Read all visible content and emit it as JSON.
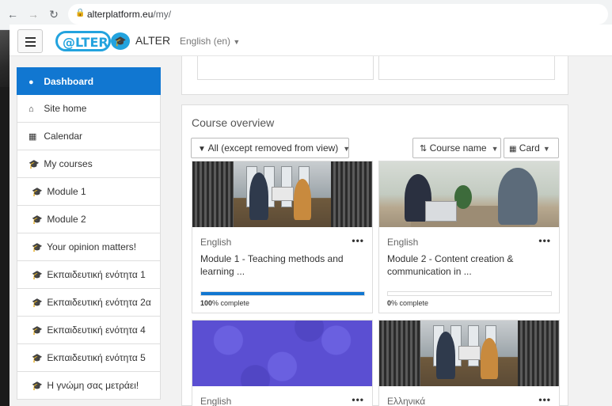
{
  "browser": {
    "url_host": "alterplatform.eu",
    "url_path": "/my/",
    "back_icon": "arrow-left-icon",
    "forward_icon": "arrow-right-icon",
    "reload_icon": "reload-icon",
    "lock_icon": "lock-icon"
  },
  "navbar": {
    "logo_text": "@LTER",
    "brand": "ALTER",
    "language": "English (en)"
  },
  "sidebar": {
    "items": [
      {
        "label": "Dashboard",
        "icon": "dashboard-icon",
        "active": true
      },
      {
        "label": "Site home",
        "icon": "home-icon"
      },
      {
        "label": "Calendar",
        "icon": "calendar-icon"
      },
      {
        "label": "My courses",
        "icon": "graduation-cap-icon"
      },
      {
        "label": "Module 1",
        "icon": "graduation-cap-icon"
      },
      {
        "label": "Module 2",
        "icon": "graduation-cap-icon"
      },
      {
        "label": "Your opinion matters!",
        "icon": "graduation-cap-icon"
      },
      {
        "label": "Εκπαιδευτική ενότητα 1",
        "icon": "graduation-cap-icon"
      },
      {
        "label": "Εκπαιδευτική ενότητα 2α",
        "icon": "graduation-cap-icon"
      },
      {
        "label": "Εκπαιδευτική ενότητα 4",
        "icon": "graduation-cap-icon"
      },
      {
        "label": "Εκπαιδευτική ενότητα 5",
        "icon": "graduation-cap-icon"
      },
      {
        "label": "Η γνώμη σας μετράει!",
        "icon": "graduation-cap-icon"
      }
    ]
  },
  "overview": {
    "title": "Course overview",
    "filter_label": "All (except removed from view)",
    "sort_label": "Course name",
    "view_label": "Card",
    "courses": [
      {
        "category": "English",
        "name": "Module 1 - Teaching methods and learning ...",
        "progress": 100,
        "progress_text": "% complete",
        "progress_value": "100"
      },
      {
        "category": "English",
        "name": "Module 2 - Content creation & communication in ...",
        "progress": 0,
        "progress_text": "% complete",
        "progress_value": "0"
      },
      {
        "category": "English",
        "name": ""
      },
      {
        "category": "Ελληνικά",
        "name": ""
      }
    ],
    "menu_dots": "•••"
  },
  "colors": {
    "accent": "#1177d1",
    "logo": "#23a3de"
  }
}
